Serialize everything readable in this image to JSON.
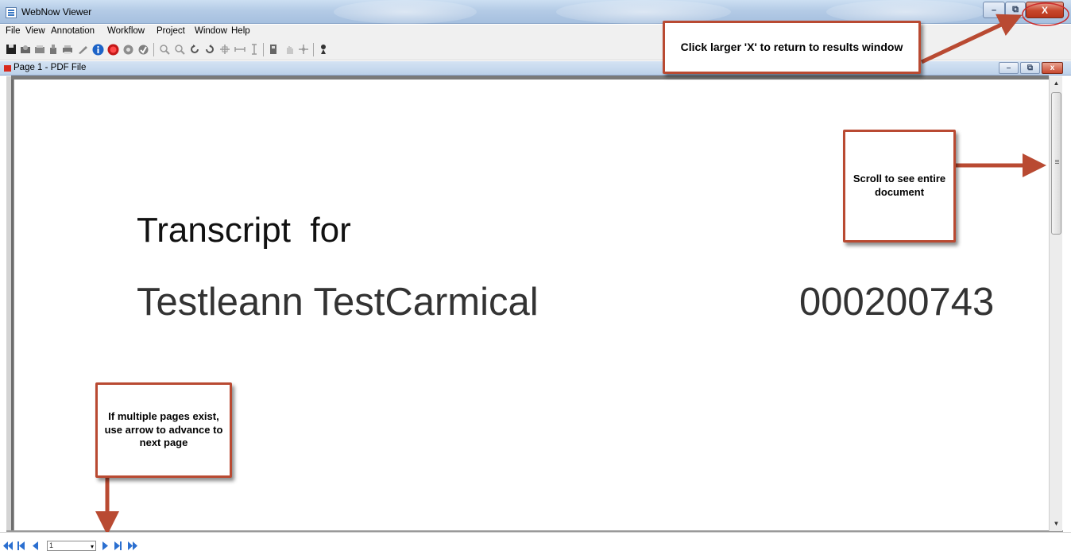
{
  "app": {
    "title": "WebNow Viewer",
    "window_buttons": {
      "minimize": "–",
      "restore": "⧉",
      "close": "X"
    }
  },
  "menu": [
    "File",
    "View",
    "Annotation",
    "Workflow",
    "Project",
    "Window",
    "Help"
  ],
  "toolbar": {
    "icons": [
      "save-icon",
      "scan-icon",
      "fax-icon",
      "export-icon",
      "print-icon",
      "annotate-icon",
      "info-icon",
      "stop-icon",
      "settings-icon",
      "route-icon",
      "zoom-in-icon",
      "zoom-out-icon",
      "rotate-left-icon",
      "rotate-right-icon",
      "fit-page-icon",
      "fit-width-icon",
      "fit-height-icon",
      "highlight-icon",
      "hand-icon",
      "pan-icon",
      "stamp-icon"
    ]
  },
  "child_window": {
    "title": "Page 1 - PDF File",
    "buttons": {
      "minimize": "–",
      "restore": "⧉",
      "close": "x"
    }
  },
  "document": {
    "line1": "Transcript  for",
    "student_name": "Testleann TestCarmical",
    "student_id": "000200743"
  },
  "callouts": {
    "close_hint": "Click larger 'X' to return to results window",
    "scroll_hint": "Scroll to see entire document",
    "pages_hint": "If multiple pages exist, use arrow to advance to next page"
  },
  "navigator": {
    "page_value": "1"
  },
  "colors": {
    "callout_border": "#b94a32",
    "arrow": "#b94a32",
    "nav_blue": "#2b6fd0",
    "close_red": "#c7462b"
  }
}
